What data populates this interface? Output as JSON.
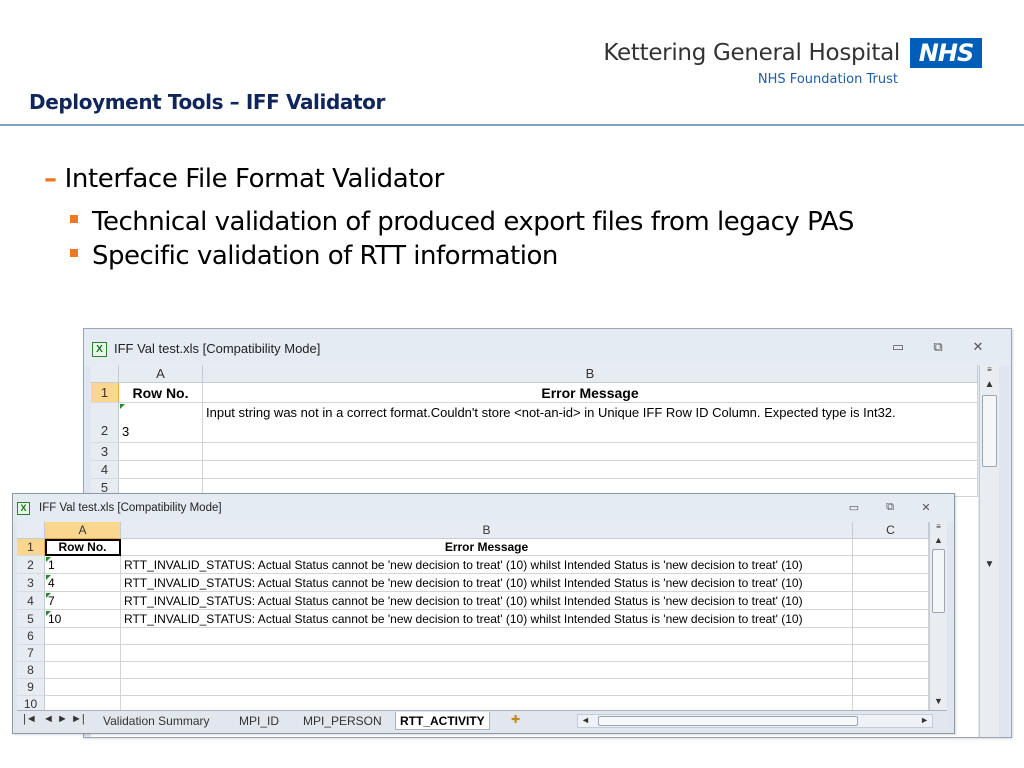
{
  "branding": {
    "org_name": "Kettering General Hospital",
    "org_sub": "NHS Foundation Trust",
    "nhs_logo": "NHS"
  },
  "slide": {
    "title": "Deployment Tools – IFF Validator",
    "bullet_level1_marker": "–",
    "bullet_level1": "Interface File Format Validator",
    "bullets_level2": [
      "Technical validation of produced export files from legacy PAS",
      "Specific validation of RTT information"
    ]
  },
  "window_back": {
    "title": "IFF Val test.xls  [Compatibility Mode]",
    "controls": {
      "minimize": "▭",
      "restore": "⧉",
      "close": "✕"
    },
    "columns": [
      "A",
      "B"
    ],
    "header_row": {
      "row": "1",
      "a": "Row No.",
      "b": "Error Message"
    },
    "row2": {
      "row": "2",
      "a": "3",
      "b": "Input string was not in a correct format.Couldn't store <not-an-id> in Unique IFF Row ID Column.  Expected type is Int32."
    },
    "empty_rows": [
      "3",
      "4",
      "5"
    ]
  },
  "window_front": {
    "title": "IFF Val test.xls  [Compatibility Mode]",
    "controls": {
      "minimize": "▭",
      "restore": "⧉",
      "close": "✕"
    },
    "columns": [
      "A",
      "B",
      "C"
    ],
    "header_row": {
      "row": "1",
      "a": "Row No.",
      "b": "Error Message"
    },
    "data_rows": [
      {
        "row": "2",
        "a": "1",
        "b": "RTT_INVALID_STATUS:  Actual Status cannot be 'new decision to treat' (10) whilst Intended Status is 'new decision to treat' (10)"
      },
      {
        "row": "3",
        "a": "4",
        "b": "RTT_INVALID_STATUS:  Actual Status cannot be 'new decision to treat' (10) whilst Intended Status is 'new decision to treat' (10)"
      },
      {
        "row": "4",
        "a": "7",
        "b": "RTT_INVALID_STATUS:  Actual Status cannot be 'new decision to treat' (10) whilst Intended Status is 'new decision to treat' (10)"
      },
      {
        "row": "5",
        "a": "10",
        "b": "RTT_INVALID_STATUS:  Actual Status cannot be 'new decision to treat' (10) whilst Intended Status is 'new decision to treat' (10)"
      }
    ],
    "empty_rows": [
      "6",
      "7",
      "8",
      "9",
      "10"
    ],
    "sheet_tabs": [
      "Validation Summary",
      "MPI_ID",
      "MPI_PERSON",
      "RTT_ACTIVITY"
    ],
    "active_tab": "RTT_ACTIVITY",
    "tab_nav": {
      "first": "|◄",
      "prev": "◄",
      "next": "►",
      "last": "►|"
    }
  },
  "icons": {
    "excel_icon": "X",
    "scroll_up": "▲",
    "scroll_down": "▼",
    "grip": "≡",
    "scroll_left": "◄",
    "scroll_right": "►",
    "new_sheet": "✚"
  }
}
